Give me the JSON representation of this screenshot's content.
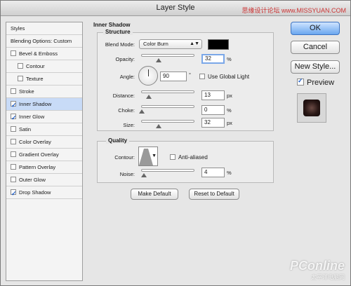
{
  "window": {
    "title": "Layer Style",
    "watermark_top": "思缘设计论坛 www.MISSYUAN.COM"
  },
  "styles_panel": {
    "header": "Styles",
    "blending": "Blending Options: Custom",
    "items": [
      {
        "label": "Bevel & Emboss",
        "checked": false,
        "indent": false,
        "selected": false
      },
      {
        "label": "Contour",
        "checked": false,
        "indent": true,
        "selected": false
      },
      {
        "label": "Texture",
        "checked": false,
        "indent": true,
        "selected": false
      },
      {
        "label": "Stroke",
        "checked": false,
        "indent": false,
        "selected": false
      },
      {
        "label": "Inner Shadow",
        "checked": true,
        "indent": false,
        "selected": true
      },
      {
        "label": "Inner Glow",
        "checked": true,
        "indent": false,
        "selected": false
      },
      {
        "label": "Satin",
        "checked": false,
        "indent": false,
        "selected": false
      },
      {
        "label": "Color Overlay",
        "checked": false,
        "indent": false,
        "selected": false
      },
      {
        "label": "Gradient Overlay",
        "checked": false,
        "indent": false,
        "selected": false
      },
      {
        "label": "Pattern Overlay",
        "checked": false,
        "indent": false,
        "selected": false
      },
      {
        "label": "Outer Glow",
        "checked": false,
        "indent": false,
        "selected": false
      },
      {
        "label": "Drop Shadow",
        "checked": true,
        "indent": false,
        "selected": false
      }
    ]
  },
  "inner_shadow": {
    "title": "Inner Shadow",
    "structure": {
      "title": "Structure",
      "blend_mode_label": "Blend Mode:",
      "blend_mode_value": "Color Burn",
      "blend_color": "#000000",
      "opacity_label": "Opacity:",
      "opacity_value": "32",
      "opacity_unit": "%",
      "angle_label": "Angle:",
      "angle_value": "90",
      "angle_unit": "°",
      "global_light_label": "Use Global Light",
      "distance_label": "Distance:",
      "distance_value": "13",
      "distance_unit": "px",
      "choke_label": "Choke:",
      "choke_value": "0",
      "choke_unit": "%",
      "size_label": "Size:",
      "size_value": "32",
      "size_unit": "px"
    },
    "quality": {
      "title": "Quality",
      "contour_label": "Contour:",
      "anti_aliased_label": "Anti-aliased",
      "noise_label": "Noise:",
      "noise_value": "4",
      "noise_unit": "%"
    },
    "make_default": "Make Default",
    "reset_default": "Reset to Default"
  },
  "actions": {
    "ok": "OK",
    "cancel": "Cancel",
    "new_style": "New Style...",
    "preview_label": "Preview"
  },
  "watermark": {
    "brand": "PConline",
    "sub": "太平洋电脑网"
  }
}
